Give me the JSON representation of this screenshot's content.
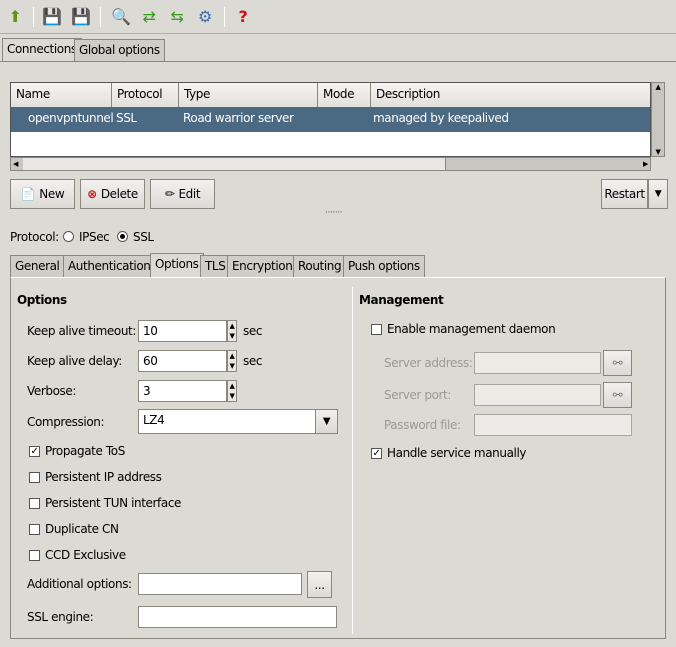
{
  "toolbar": {
    "icons": [
      "up-arrow-icon",
      "save-restore-icon",
      "save-revert-icon",
      "search-icon",
      "import-icon",
      "export-icon",
      "gear-icon",
      "help-icon"
    ]
  },
  "top_tabs": [
    {
      "label": "Connections",
      "active": true
    },
    {
      "label": "Global options",
      "active": false
    }
  ],
  "table": {
    "columns": [
      "Name",
      "Protocol",
      "Type",
      "Mode",
      "Description"
    ],
    "rows": [
      {
        "name": "openvpntunnel",
        "protocol": "SSL",
        "type": "Road warrior server",
        "mode": "",
        "description": "managed by keepalived",
        "selected": true
      }
    ]
  },
  "buttons": {
    "new": "New",
    "delete": "Delete",
    "edit": "Edit",
    "restart": "Restart"
  },
  "splitter": "·······",
  "protocol": {
    "label": "Protocol:",
    "options": [
      "IPSec",
      "SSL"
    ],
    "selected": "SSL"
  },
  "sub_tabs": [
    {
      "label": "General"
    },
    {
      "label": "Authentication"
    },
    {
      "label": "Options",
      "active": true
    },
    {
      "label": "TLS"
    },
    {
      "label": "Encryption"
    },
    {
      "label": "Routing"
    },
    {
      "label": "Push options"
    }
  ],
  "options": {
    "title": "Options",
    "keep_alive_timeout": {
      "label": "Keep alive timeout:",
      "value": "10",
      "unit": "sec"
    },
    "keep_alive_delay": {
      "label": "Keep alive delay:",
      "value": "60",
      "unit": "sec"
    },
    "verbose": {
      "label": "Verbose:",
      "value": "3"
    },
    "compression": {
      "label": "Compression:",
      "value": "LZ4"
    },
    "checks": [
      {
        "label": "Propagate ToS",
        "checked": true
      },
      {
        "label": "Persistent IP address",
        "checked": false
      },
      {
        "label": "Persistent TUN interface",
        "checked": false
      },
      {
        "label": "Duplicate CN",
        "checked": false
      },
      {
        "label": "CCD Exclusive",
        "checked": false
      }
    ],
    "additional_options": {
      "label": "Additional options:",
      "value": "",
      "browse": "..."
    },
    "ssl_engine": {
      "label": "SSL engine:",
      "value": ""
    }
  },
  "management": {
    "title": "Management",
    "enable": {
      "label": "Enable management daemon",
      "checked": false
    },
    "server_address": {
      "label": "Server address:",
      "value": ""
    },
    "server_port": {
      "label": "Server port:",
      "value": ""
    },
    "password_file": {
      "label": "Password file:",
      "value": ""
    },
    "handle_manually": {
      "label": "Handle service manually",
      "checked": true
    }
  }
}
